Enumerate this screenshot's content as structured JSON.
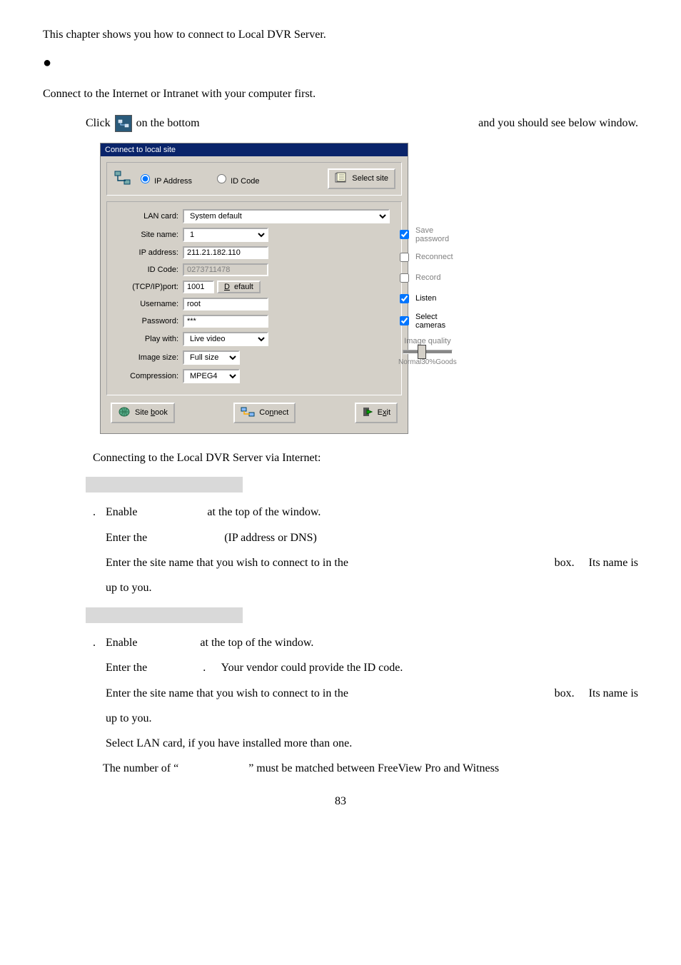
{
  "intro": "This chapter shows you how to connect to Local DVR Server.",
  "step1": "Connect to the Internet or Intranet with your computer first.",
  "click_prefix": "Click",
  "click_mid": "on the bottom",
  "click_suffix": "and you should see below window.",
  "dialog": {
    "title": "Connect to local site",
    "radio_ip": "IP Address",
    "radio_id": "ID Code",
    "select_site_btn": "Select site",
    "labels": {
      "lan": "LAN card:",
      "site": "Site name:",
      "ip": "IP address:",
      "idcode": "ID Code:",
      "port": "(TCP/IP)port:",
      "user": "Username:",
      "pass": "Password:",
      "play": "Play with:",
      "imgsize": "Image size:",
      "comp": "Compression:"
    },
    "values": {
      "lan": "System default",
      "site": "1",
      "ip": "211.21.182.110",
      "idcode": "0273711478",
      "port": "1001",
      "default_btn": "Default",
      "user": "root",
      "pass": "***",
      "play": "Live video",
      "imgsize": "Full size",
      "comp": "MPEG4"
    },
    "checks": {
      "save_pw": "Save password",
      "reconnect": "Reconnect",
      "record": "Record",
      "listen": "Listen",
      "select_cams": "Select cameras"
    },
    "slider": {
      "title": "Image quality",
      "left": "Normal",
      "mid": "30%",
      "right": "Goods"
    },
    "buttons": {
      "sitebook": "Site book",
      "connect": "Connect",
      "exit": "Exit"
    }
  },
  "after_dialog": "Connecting to the Local DVR Server via Internet:",
  "blockA": {
    "l1a": "Enable",
    "l1b": "at the top of the window.",
    "l2a": "Enter the",
    "l2b": "(IP address or DNS)",
    "l3": "Enter the site name that you wish to connect to in the",
    "l3b": "box.",
    "l3c": "Its name is",
    "l4": " up to you."
  },
  "blockB": {
    "l1a": "Enable",
    "l1b": "at the top of the window.",
    "l2a": "Enter the",
    "l2b": ".",
    "l2c": "Your vendor could provide the ID code.",
    "l3": "Enter the site name that you wish to connect to in the",
    "l3b": "box.",
    "l3c": "Its name is",
    "l4": " up to you.",
    "l5": "Select LAN card, if you have installed more than one.",
    "l6a": " The number of “",
    "l6b": "” must be matched between FreeView Pro and Witness"
  },
  "page_number": "83"
}
